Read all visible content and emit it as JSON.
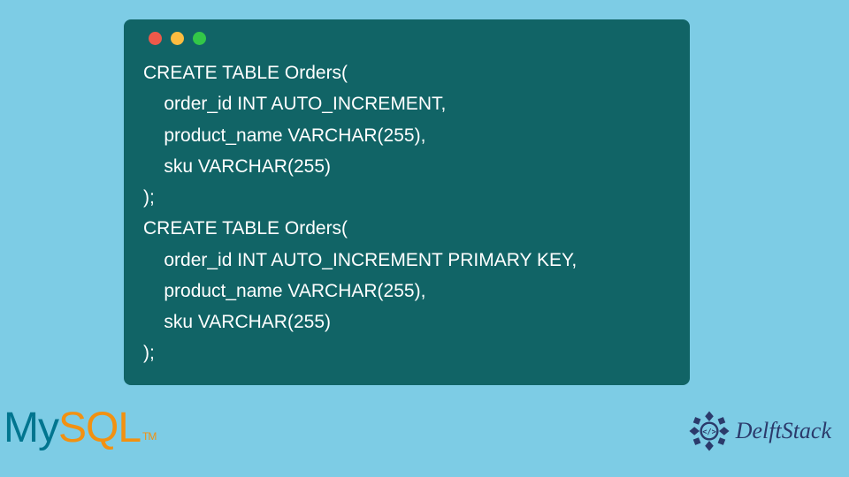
{
  "code": {
    "lines": [
      "CREATE TABLE Orders(",
      "    order_id INT AUTO_INCREMENT,",
      "    product_name VARCHAR(255),",
      "    sku VARCHAR(255)",
      ");",
      "CREATE TABLE Orders(",
      "    order_id INT AUTO_INCREMENT PRIMARY KEY,",
      "    product_name VARCHAR(255),",
      "    sku VARCHAR(255)",
      ");"
    ]
  },
  "logos": {
    "mysql_my": "My",
    "mysql_sql": "SQL",
    "mysql_tm": "TM",
    "delftstack": "DelftStack"
  }
}
